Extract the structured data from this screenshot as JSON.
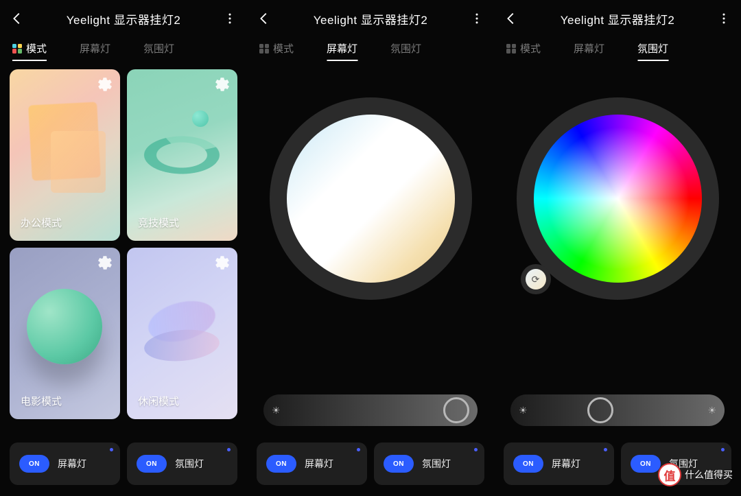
{
  "header": {
    "title": "Yeelight 显示器挂灯2"
  },
  "tabs": {
    "mode": "模式",
    "screen": "屏幕灯",
    "ambient": "氛围灯"
  },
  "modes": {
    "office": "办公模式",
    "gaming": "竞技模式",
    "movie": "电影模式",
    "leisure": "休闲模式"
  },
  "toggles": {
    "on_label": "ON",
    "screen": "屏幕灯",
    "ambient": "氛围灯"
  },
  "watermark": {
    "badge": "值",
    "text": "什么值得买"
  }
}
